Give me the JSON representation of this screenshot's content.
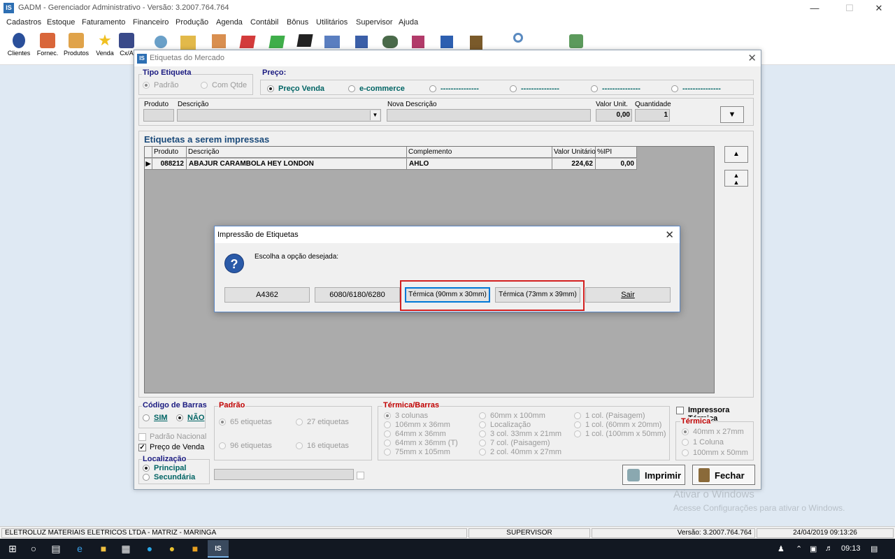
{
  "app": {
    "title": "GADM - Gerenciador Administrativo - Versão: 3.2007.764.764",
    "logo": "IS"
  },
  "menu": [
    "Cadastros",
    "Estoque",
    "Faturamento",
    "Financeiro",
    "Produção",
    "Agenda",
    "Contábil",
    "Bônus",
    "Utilitários",
    "Supervisor",
    "Ajuda"
  ],
  "toolbar": {
    "labels": [
      "Clientes",
      "Fornec.",
      "Produtos",
      "Venda",
      "Cx/A"
    ],
    "icons": [
      "clients-icon",
      "supplier-icon",
      "products-icon",
      "sale-icon",
      "cash-icon",
      "backup-icon",
      "checklist-icon",
      "edit-icon",
      "red-tag-icon",
      "green-tag-icon",
      "black-tag-icon",
      "tools-icon",
      "calendar-icon",
      "users-icon",
      "shield-icon",
      "save-icon",
      "exit-icon",
      "search-icon",
      "user-settings-icon"
    ]
  },
  "etiquetas": {
    "title": "Etiquetas do Mercado",
    "tipo": {
      "label": "Tipo Etiqueta",
      "opt1": "Padrão",
      "opt2": "Com Qtde"
    },
    "preco": {
      "label": "Preço:",
      "opt1": "Preço Venda",
      "opt2": "e-commerce",
      "opt3": "---------------",
      "opt4": "---------------",
      "opt5": "---------------",
      "opt6": "---------------"
    },
    "fields": {
      "produto": "Produto",
      "descricao": "Descrição",
      "nova_descricao": "Nova Descrição",
      "valor_unit": "Valor Unit.",
      "valor_unit_value": "0,00",
      "quantidade": "Quantidade",
      "quantidade_value": "1"
    },
    "grid": {
      "title": "Etiquetas a serem impressas",
      "columns": [
        "Produto",
        "Descrição",
        "Complemento",
        "Valor Unitário",
        "%IPI"
      ],
      "rows": [
        {
          "produto": "088212",
          "descricao": "ABAJUR CARAMBOLA HEY LONDON",
          "complemento": "AHLO",
          "valor": "224,62",
          "ipi": "0,00"
        }
      ]
    },
    "codigo_barras": {
      "label": "Código de Barras",
      "sim": "SIM",
      "nao": "NÃO"
    },
    "padrao_nacional": "Padrão Nacional",
    "preco_venda": "Preço de Venda",
    "localizacao": {
      "label": "Localização",
      "principal": "Principal",
      "secundaria": "Secundária"
    },
    "padrao": {
      "label": "Padrão",
      "o1": "65 etiquetas",
      "o2": "27 etiquetas",
      "o3": "96 etiquetas",
      "o4": "16 etiquetas"
    },
    "termica_barras": {
      "label": "Térmica/Barras",
      "c1": [
        "3 colunas",
        "106mm x 36mm",
        "64mm x 36mm",
        "64mm x 36mm (T)",
        "75mm x 105mm"
      ],
      "c2": [
        "60mm x 100mm",
        "Localização",
        "3 col. 33mm x 21mm",
        "7 col. (Paisagem)",
        "2 col. 40mm x 27mm"
      ],
      "c3": [
        "1 col. (Paisagem)",
        "1 col. (60mm x 20mm)",
        "1 col. (100mm x 50mm)"
      ]
    },
    "impressora_termica": "Impressora Térmica",
    "termica": {
      "label": "Térmica",
      "o1": "40mm x 27mm",
      "o2": "1 Coluna",
      "o3": "100mm x 50mm"
    },
    "buttons": {
      "imprimir": "Imprimir",
      "fechar": "Fechar"
    }
  },
  "dialog": {
    "title": "Impressão de Etiquetas",
    "message": "Escolha a opção desejada:",
    "buttons": [
      "A4362",
      "6080/6180/6280",
      "Térmica (90mm x 30mm)",
      "Térmica (73mm x 39mm)",
      "Sair"
    ]
  },
  "status": {
    "empresa": "ELETROLUZ MATERIAIS ELETRICOS LTDA  -  MATRIZ - MARINGA",
    "usuario": "SUPERVISOR",
    "versao": "Versão: 3.2007.764.764",
    "datahora": "24/04/2019 09:13:26"
  },
  "watermark": {
    "line1": "Ativar o Windows",
    "line2": "Acesse Configurações para ativar o Windows."
  },
  "taskbar": {
    "time": "09:13"
  },
  "colors": {
    "highlight_box": "#d32020",
    "accent": "#2d6fb3"
  }
}
